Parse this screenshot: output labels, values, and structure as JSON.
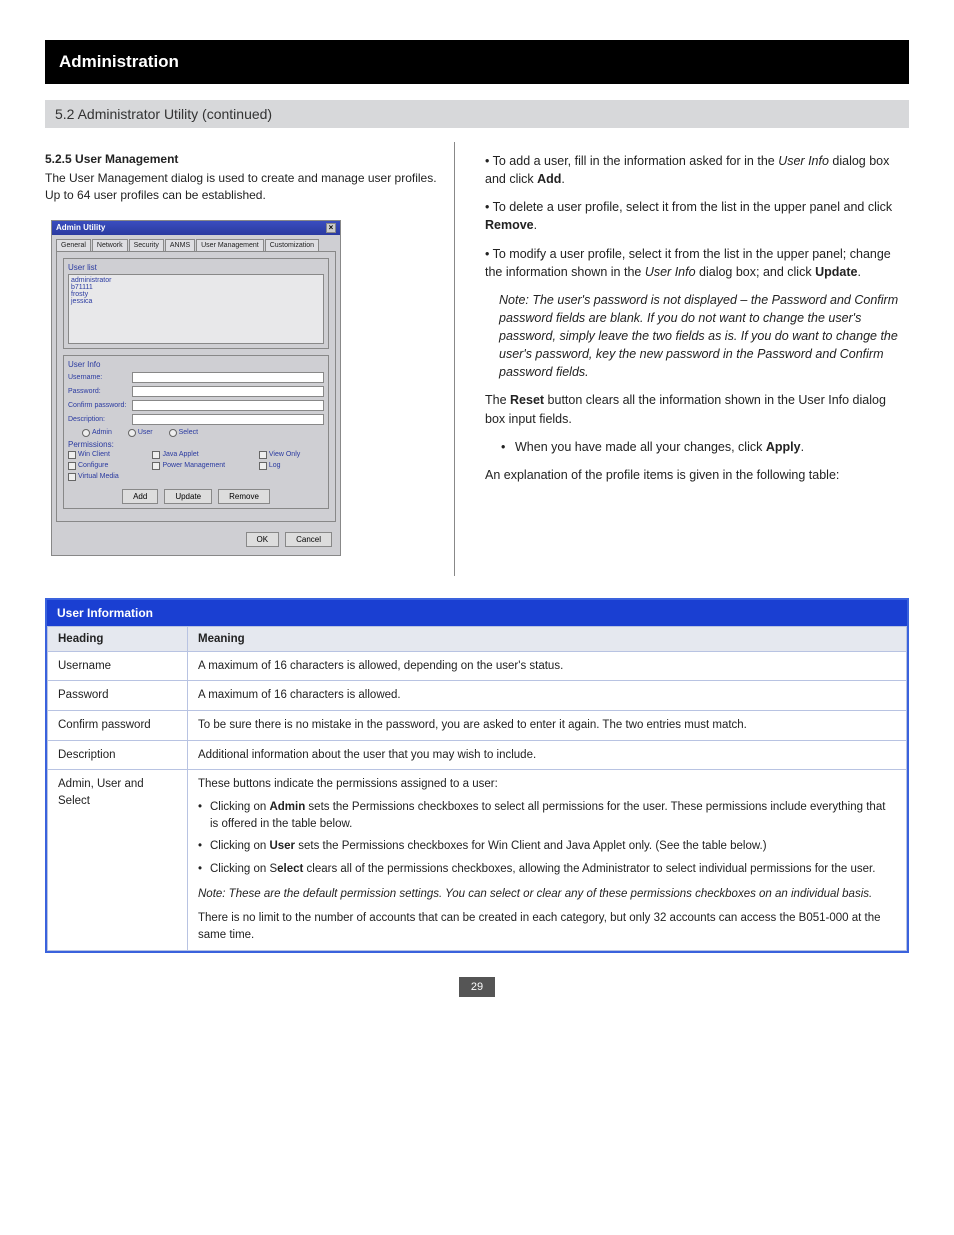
{
  "page_title": "Administration",
  "section_title": "5.2 Administrator Utility (continued)",
  "page_number": "29",
  "left": {
    "intro_heading": "5.2.5 User Management",
    "intro_text": "The User Management dialog is used to create and manage user profiles. Up to 64 user profiles can be established."
  },
  "right": {
    "add_text_1": "• To add a user, fill in the information asked for in the ",
    "add_text_em": "User Info",
    "add_text_2": " dialog box and click ",
    "add_text_btn": "Add",
    "del_text_1": "• To delete a user profile, select it from the list in the upper panel and click ",
    "del_text_btn": "Remove",
    "mod_text_1": "• To modify a user profile, select it from the list in the upper panel; change the information shown in the ",
    "mod_text_em": "User Info",
    "mod_text_2": " dialog box; and click ",
    "mod_text_btn": "Update",
    "note": "Note: The user's password is not displayed – the Password and Confirm password fields are blank. If you do not want to change the user's password, simply leave the two fields as is. If you do want to change the user's password, key the new password in the Password and Confirm password fields.",
    "reset_text_1": "The ",
    "reset_text_btn": "Reset",
    "reset_text_2": " button clears all the information shown in the User Info dialog box input fields.",
    "final_1": "When you have made all your changes, click ",
    "final_btn": "Apply",
    "explain": "An explanation of the profile items is given in the following table:"
  },
  "dialog": {
    "title": "Admin Utility",
    "tabs": [
      "General",
      "Network",
      "Security",
      "ANMS",
      "User Management",
      "Customization"
    ],
    "group_userlist": "User list",
    "users": [
      "administrator",
      "b71111",
      "frosty",
      "jessica"
    ],
    "group_userinfo": "User Info",
    "f_username": "Username:",
    "f_password": "Password:",
    "f_confirm": "Confirm password:",
    "f_description": "Description:",
    "r_admin": "Admin",
    "r_user": "User",
    "r_select": "Select",
    "group_perm": "Permissions:",
    "p_winclient": "Win Client",
    "p_java": "Java Applet",
    "p_viewonly": "View Only",
    "p_configure": "Configure",
    "p_power": "Power Management",
    "p_log": "Log",
    "p_virtual": "Virtual Media",
    "b_add": "Add",
    "b_update": "Update",
    "b_remove": "Remove",
    "b_ok": "OK",
    "b_cancel": "Cancel"
  },
  "table": {
    "header": "User Information",
    "col_heading": "Heading",
    "col_meaning": "Meaning",
    "r_username_h": "Username",
    "r_username_m": "A maximum of 16 characters is allowed, depending on the user's status.",
    "r_password_h": "Password",
    "r_password_m": "A maximum of 16 characters is allowed.",
    "r_confirm_h": "Confirm password",
    "r_confirm_m": "To be sure there is no mistake in the password, you are asked to enter it again. The two entries must match.",
    "r_description_h": "Description",
    "r_description_m": "Additional information about the user that you may wish to include.",
    "r_aus_h": "Admin, User and Select",
    "r_aus_intro": "These buttons indicate the permissions assigned to a user:",
    "r_aus_li1a": "Clicking on ",
    "r_aus_li1b": "Admin",
    "r_aus_li1c": " sets the Permissions checkboxes to select all permissions for the user. These permissions include everything that is offered in the table below.",
    "r_aus_li2a": "Clicking on ",
    "r_aus_li2b": "User",
    "r_aus_li2c": " sets the Permissions checkboxes for Win Client and Java Applet only. (See the table below.)",
    "r_aus_li3a": "Clicking on S",
    "r_aus_li3b": "elect",
    "r_aus_li3c": " clears all of the permissions checkboxes, allowing the Administrator to select individual permissions for the user.",
    "r_aus_note": "Note: These are the default permission settings. You can select or clear any of these permissions checkboxes on an individual basis.",
    "r_aus_note2": "There is no limit to the number of accounts that can be created in each category, but only 32 accounts can access the B051-000 at the same time."
  }
}
